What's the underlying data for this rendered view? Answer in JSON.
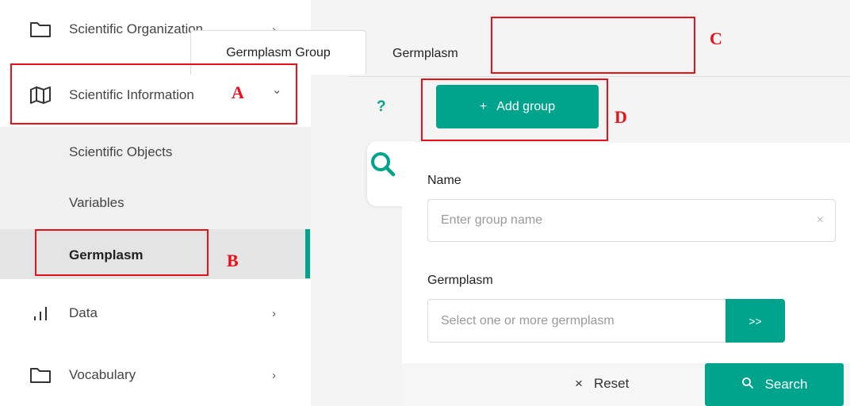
{
  "sidebar": {
    "items": [
      {
        "label": "Scientific Organization",
        "icon": "folder-icon",
        "chevron": "›"
      },
      {
        "label": "Scientific Information",
        "icon": "map-icon",
        "chevron": "⌄"
      },
      {
        "label": "Data",
        "icon": "bar-chart-icon",
        "chevron": "›"
      },
      {
        "label": "Vocabulary",
        "icon": "folder-icon",
        "chevron": "›"
      }
    ],
    "subitems": [
      {
        "label": "Scientific Objects"
      },
      {
        "label": "Variables"
      },
      {
        "label": "Germplasm"
      }
    ]
  },
  "tabs": [
    {
      "label": "Germplasm"
    },
    {
      "label": "Germplasm Group"
    }
  ],
  "toolbar": {
    "help": "?",
    "add_icon": "+",
    "add_label": "Add group"
  },
  "form": {
    "name_label": "Name",
    "name_placeholder": "Enter group name",
    "name_clear": "×",
    "germplasm_label": "Germplasm",
    "germplasm_placeholder": "Select one or more germplasm",
    "germplasm_button": ">>",
    "reset_icon": "×",
    "reset_label": "Reset",
    "search_label": "Search"
  },
  "annotations": {
    "a": "A",
    "b": "B",
    "c": "C",
    "d": "D"
  },
  "colors": {
    "accent": "#00a38b",
    "annotation": "#e8101a"
  }
}
